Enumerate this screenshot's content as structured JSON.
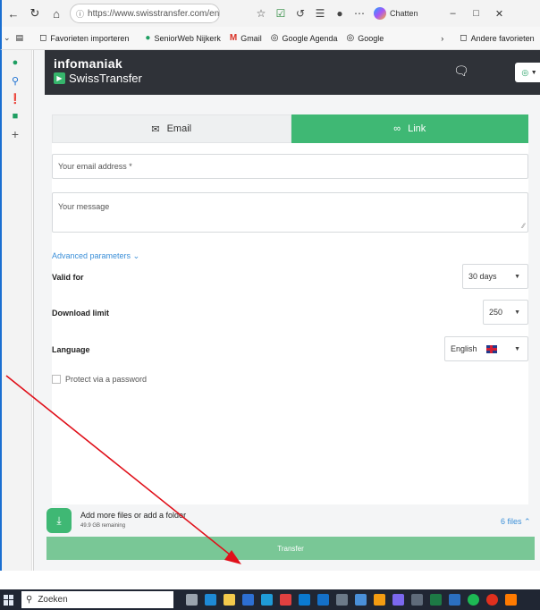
{
  "browser": {
    "url": "https://www.swisstransfer.com/en",
    "chat_label": "Chatten",
    "favorites": [
      {
        "label": "Favorieten importeren",
        "icon": "folder-import-icon"
      },
      {
        "label": "SeniorWeb Nijkerk",
        "icon": "seniorweb-icon"
      },
      {
        "label": "Gmail",
        "icon": "gmail-icon"
      },
      {
        "label": "Google Agenda",
        "icon": "globe-icon"
      },
      {
        "label": "Google",
        "icon": "globe-icon"
      }
    ],
    "other_favorites": "Andere favorieten"
  },
  "header": {
    "brand_top": "infomaniak",
    "brand_bottom": "SwissTransfer"
  },
  "form": {
    "tab_email": "Email",
    "tab_link": "Link",
    "active_tab": "Link",
    "email_placeholder": "Your email address *",
    "message_placeholder": "Your message",
    "advanced_link": "Advanced parameters",
    "valid_for_label": "Valid for",
    "valid_for_value": "30 days",
    "download_limit_label": "Download limit",
    "download_limit_value": "250",
    "language_label": "Language",
    "language_value": "English",
    "password_label": "Protect via a password"
  },
  "files": {
    "title": "Add more files or add a folder",
    "remaining": "49.9 GB remaining",
    "count": "6 files"
  },
  "transfer_button": "Transfer",
  "taskbar": {
    "search_placeholder": "Zoeken"
  },
  "colors": {
    "accent": "#3fb874",
    "header_bg": "#2f3238",
    "link_blue": "#3b8fd8",
    "arrow_red": "#e0101a"
  }
}
